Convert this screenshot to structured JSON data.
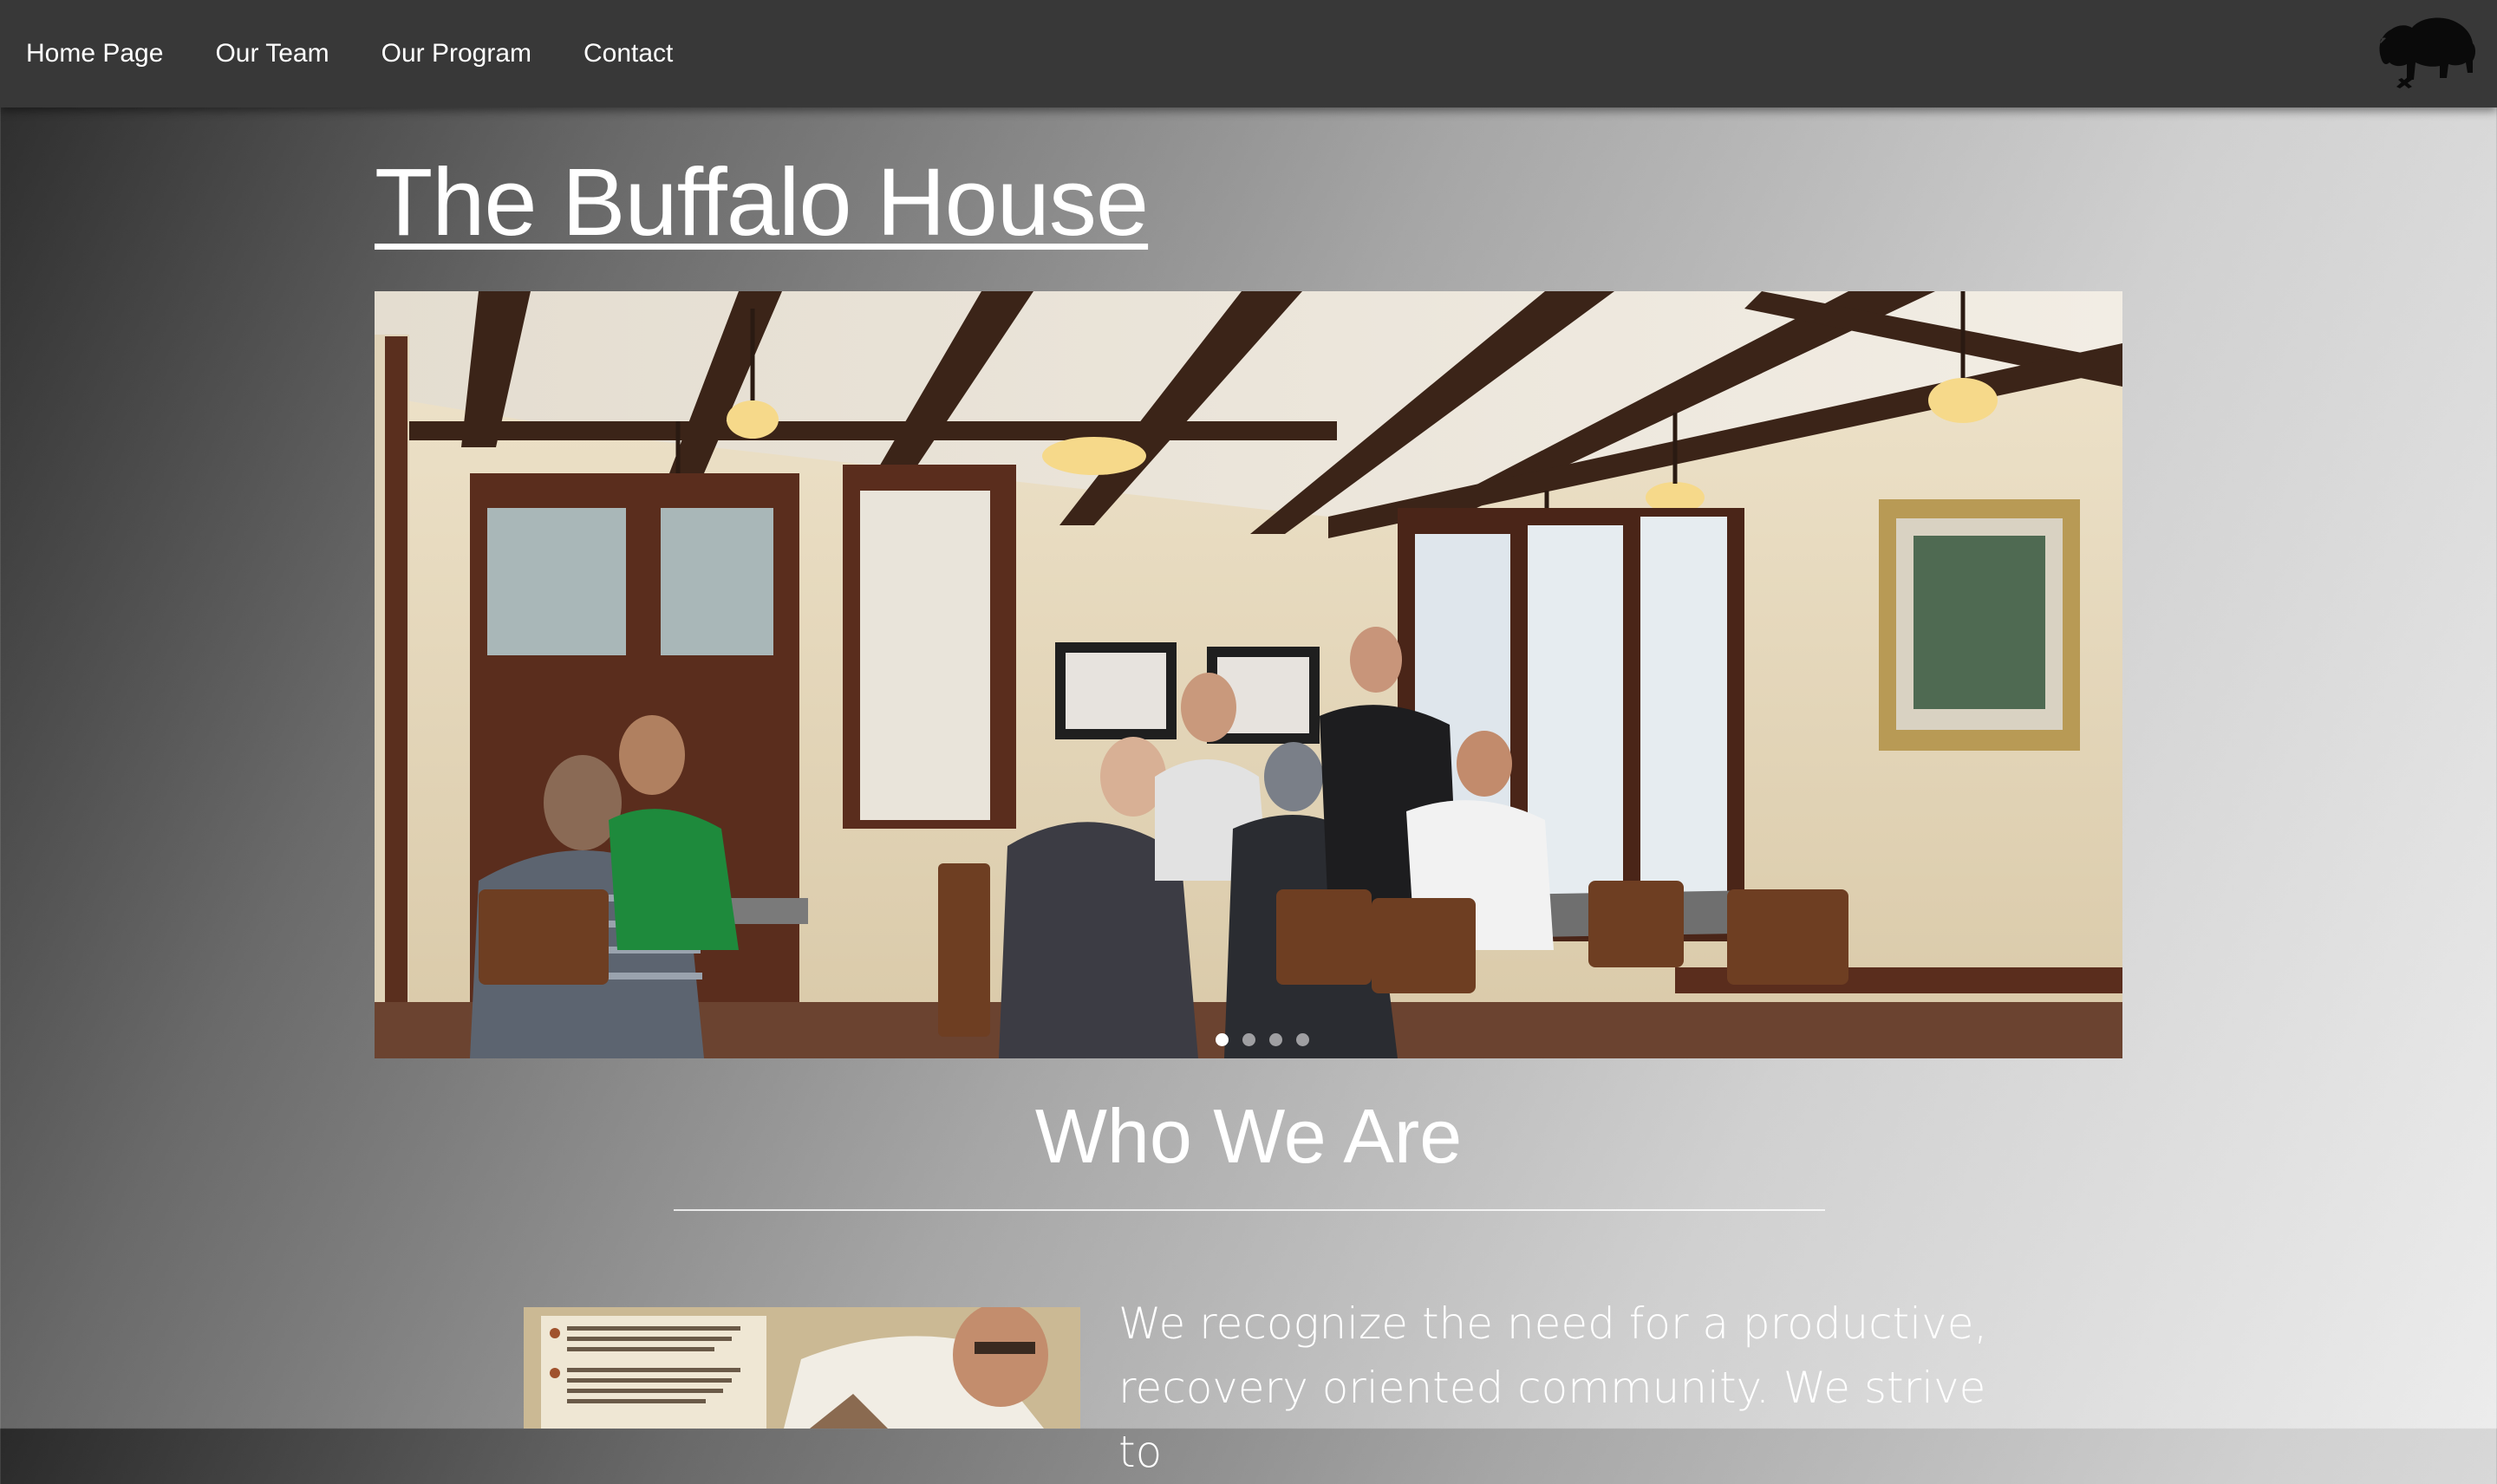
{
  "nav": {
    "items": [
      {
        "label": "Home Page"
      },
      {
        "label": "Our Team"
      },
      {
        "label": "Our Program"
      },
      {
        "label": "Contact"
      }
    ],
    "logo_icon": "buffalo-icon",
    "background": "#383838"
  },
  "site_title": "The Buffalo House",
  "carousel": {
    "image": "Group of men talking around tables in a wood-beamed dining room",
    "slide_count": 4,
    "active_slide": 1
  },
  "about": {
    "heading": "Who We Are",
    "text": "We recognize the need for a productive, recovery oriented community. We strive to"
  },
  "colors": {
    "text": "#ffffff",
    "nav_bg": "#383838"
  }
}
